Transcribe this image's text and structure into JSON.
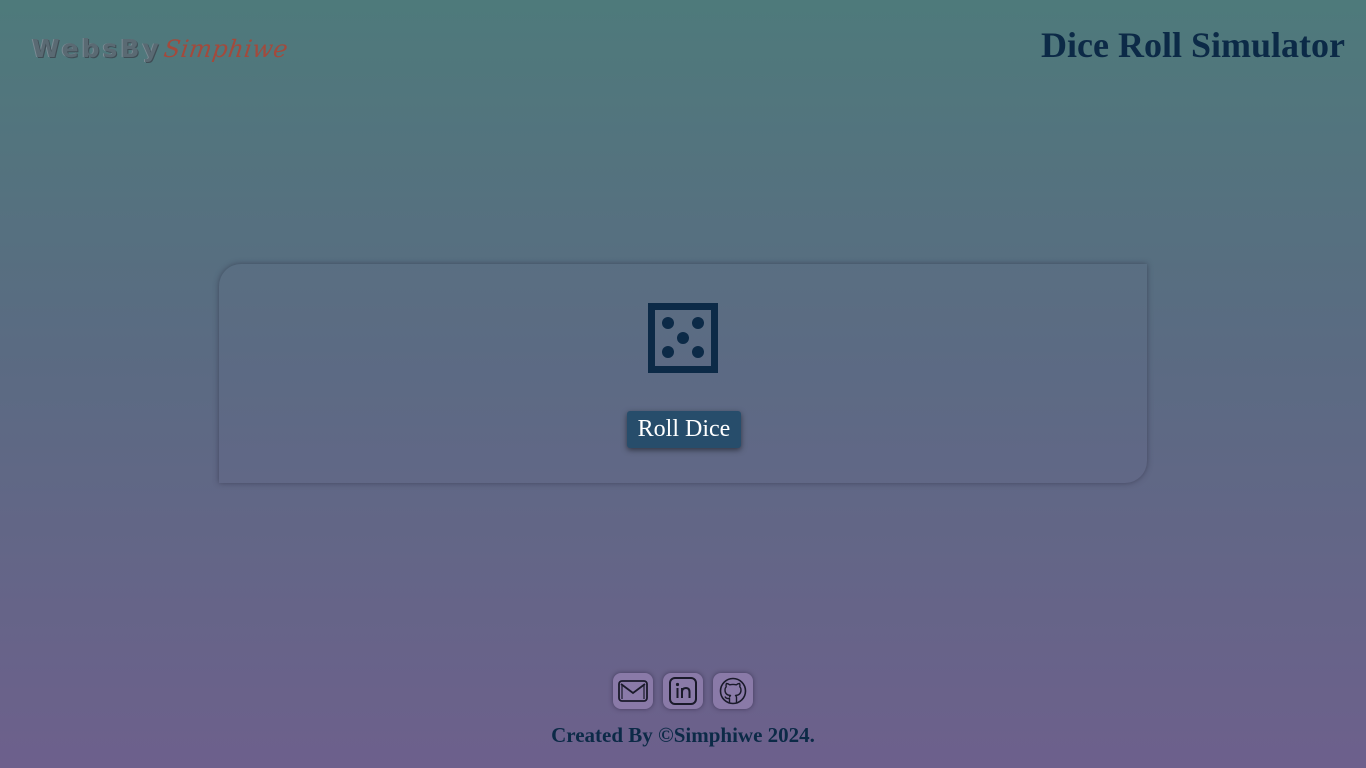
{
  "header": {
    "logo_part1": "WebsBy",
    "logo_part2": "Simphiwe",
    "title": "Dice Roll Simulator"
  },
  "main": {
    "die_face": 5,
    "die_icon": "dice-five-icon",
    "roll_button_label": "Roll Dice"
  },
  "footer": {
    "social_links": [
      {
        "icon": "mail-icon"
      },
      {
        "icon": "linkedin-icon"
      },
      {
        "icon": "github-icon"
      }
    ],
    "copyright": "Created By ©Simphiwe 2024."
  },
  "colors": {
    "title": "#0c2a47",
    "button_bg": "#274d6b",
    "die": "#0c2a47"
  }
}
